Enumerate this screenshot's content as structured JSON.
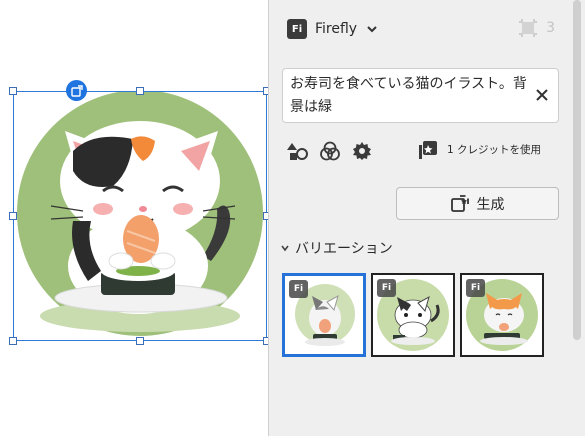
{
  "panel": {
    "app_logo_text": "Fi",
    "app_name": "Firefly",
    "layer_count": "3",
    "prompt_text": "お寿司を食べている猫のイラスト。背景は緑",
    "credit_text": "1 クレジットを使用",
    "generate_label": "生成",
    "variations_label": "バリエーション"
  },
  "thumbnails": [
    {
      "badge": "Fi"
    },
    {
      "badge": "Fi"
    },
    {
      "badge": "Fi"
    }
  ],
  "colors": {
    "accent": "#2672d8",
    "background_green": "#9fc07a",
    "panel_bg": "#efefef"
  }
}
